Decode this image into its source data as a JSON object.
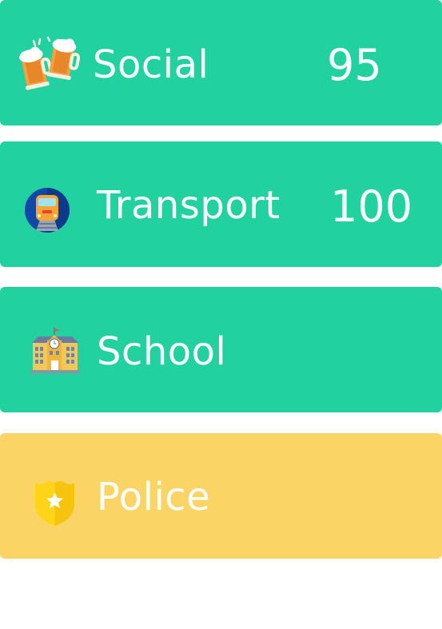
{
  "colors": {
    "green": "#21d1a0",
    "yellow": "#fbd466",
    "text": "#ffffff"
  },
  "cards": [
    {
      "label": "Social",
      "score": "95",
      "icon": "beer-mugs-icon",
      "status": "green"
    },
    {
      "label": "Transport",
      "score": "100",
      "icon": "train-icon",
      "status": "green"
    },
    {
      "label": "School",
      "score": "",
      "icon": "school-building-icon",
      "status": "green"
    },
    {
      "label": "Police",
      "score": "",
      "icon": "police-badge-icon",
      "status": "yellow"
    }
  ]
}
